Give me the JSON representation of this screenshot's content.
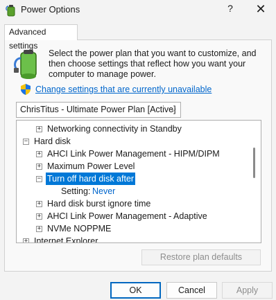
{
  "window": {
    "title": "Power Options",
    "help_label": "?",
    "close_label": "✕"
  },
  "tab": {
    "label": "Advanced settings"
  },
  "description": "Select the power plan that you want to customize, and then choose settings that reflect how you want your computer to manage power.",
  "change_link": "Change settings that are currently unavailable",
  "plan_select": {
    "value": "ChrisTitus - Ultimate Power Plan [Active]",
    "chevron": "⌵"
  },
  "tree": {
    "rows": [
      {
        "label": "Networking connectivity in Standby",
        "expander": "+"
      },
      {
        "label": "Hard disk",
        "expander": "−"
      },
      {
        "label": "AHCI Link Power Management - HIPM/DIPM",
        "expander": "+"
      },
      {
        "label": "Maximum Power Level",
        "expander": "+"
      },
      {
        "label": "Turn off hard disk after",
        "expander": "−",
        "selected": true
      },
      {
        "label": "Setting:",
        "value": "Never"
      },
      {
        "label": "Hard disk burst ignore time",
        "expander": "+"
      },
      {
        "label": "AHCI Link Power Management - Adaptive",
        "expander": "+"
      },
      {
        "label": "NVMe NOPPME",
        "expander": "+"
      },
      {
        "label": "Internet Explorer",
        "expander": "+"
      }
    ]
  },
  "buttons": {
    "restore": "Restore plan defaults",
    "ok": "OK",
    "cancel": "Cancel",
    "apply": "Apply"
  },
  "colors": {
    "selection": "#0078d7",
    "link": "#0066cc",
    "ok_border": "#0067c0"
  }
}
